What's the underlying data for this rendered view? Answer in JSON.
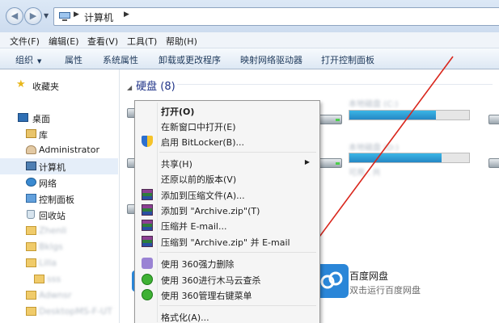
{
  "address": {
    "path_label": "计算机"
  },
  "menubar": [
    "文件(F)",
    "编辑(E)",
    "查看(V)",
    "工具(T)",
    "帮助(H)"
  ],
  "toolbar": [
    "组织",
    "属性",
    "系统属性",
    "卸载或更改程序",
    "映射网络驱动器",
    "打开控制面板"
  ],
  "nav": {
    "favorites": "收藏夹",
    "desktop": "桌面",
    "libraries": "库",
    "user": "Administrator",
    "computer": "计算机",
    "network": "网络",
    "control_panel": "控制面板",
    "recycle_bin": "回收站",
    "folders_blurred": [
      "Zhenli",
      "Bklgs",
      "Lilla",
      "sss",
      "Adwnsr",
      "DesktopMS-F-UT"
    ]
  },
  "content": {
    "group_hdd": "硬盘 (8)",
    "drives": [
      {
        "name_blurred": "本地磁盘 (C:)",
        "stat_blurred": "",
        "fill": 0.4
      },
      {
        "name_blurred": "本地磁盘 (D:)",
        "stat_blurred": "可用 , 共",
        "fill": 0.42
      },
      {
        "name_blurred": "本地磁盘 (E:)",
        "stat_blurred": "可用 , 共",
        "fill": 0.5
      }
    ],
    "baidu_title": "百度网盘",
    "baidu_sub": "双击运行百度网盘"
  },
  "context_menu": {
    "items": [
      {
        "label": "打开(O)",
        "bold": true,
        "icon": ""
      },
      {
        "label": "在新窗口中打开(E)",
        "icon": ""
      },
      {
        "label": "启用 BitLocker(B)...",
        "icon": "shield-icon"
      },
      {
        "label": "共享(H)",
        "icon": "",
        "submenu": true
      },
      {
        "label": "还原以前的版本(V)",
        "icon": ""
      },
      {
        "label": "添加到压缩文件(A)...",
        "icon": "winrar-icon"
      },
      {
        "label": "添加到 \"Archive.zip\"(T)",
        "icon": "winrar-icon"
      },
      {
        "label": "压缩并 E-mail...",
        "icon": "winrar-icon"
      },
      {
        "label": "压缩到 \"Archive.zip\" 并 E-mail",
        "icon": "winrar-icon"
      },
      {
        "label": "使用 360强力删除",
        "icon": "360-delete-icon"
      },
      {
        "label": "使用 360进行木马云查杀",
        "icon": "360-icon"
      },
      {
        "label": "使用 360管理右键菜单",
        "icon": "360-icon"
      },
      {
        "label": "格式化(A)...",
        "icon": ""
      }
    ]
  },
  "colors": {
    "accent_red_line": "#d9261c",
    "selection": "#e5eef9",
    "group_header": "#1e3287"
  }
}
